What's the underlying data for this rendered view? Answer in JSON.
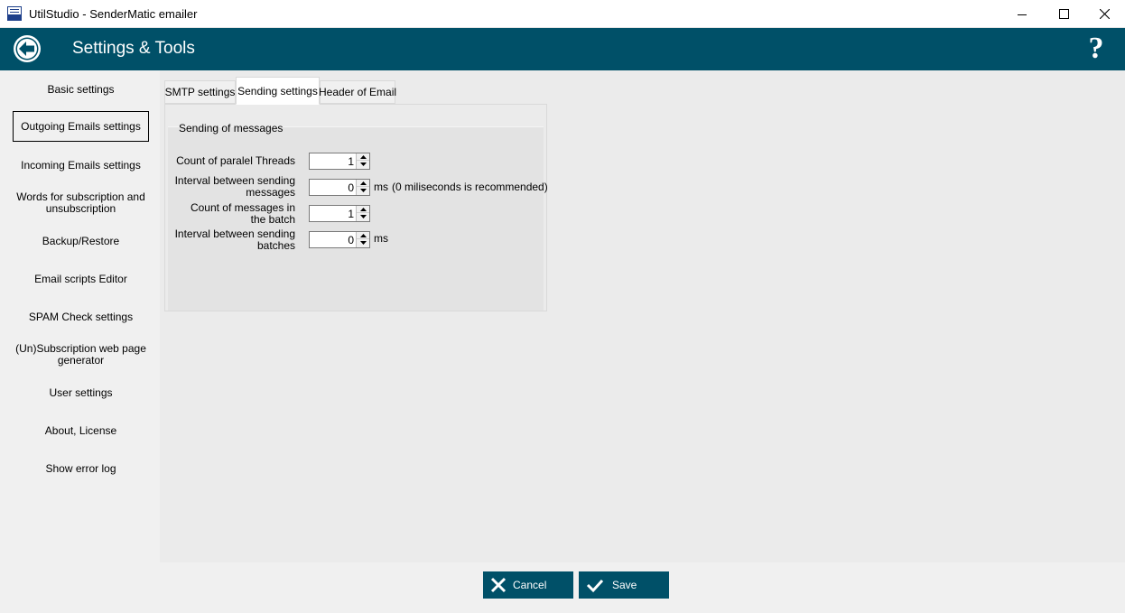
{
  "window": {
    "title": "UtilStudio - SenderMatic emailer"
  },
  "header": {
    "title": "Settings & Tools",
    "help_label": "?"
  },
  "sidebar": {
    "items": [
      {
        "label": "Basic settings"
      },
      {
        "label": "Outgoing Emails settings",
        "active": true
      },
      {
        "label": "Incoming Emails settings"
      },
      {
        "label": "Words for subscription and unsubscription"
      },
      {
        "label": "Backup/Restore"
      },
      {
        "label": "Email scripts Editor"
      },
      {
        "label": "SPAM Check settings"
      },
      {
        "label": "(Un)Subscription web page generator"
      },
      {
        "label": "User settings"
      },
      {
        "label": "About, License"
      },
      {
        "label": "Show error log"
      }
    ]
  },
  "tabs": [
    {
      "label": "SMTP settings"
    },
    {
      "label": "Sending settings",
      "active": true
    },
    {
      "label": "Header of Email"
    }
  ],
  "sending": {
    "group_title": "Sending of messages",
    "fields": [
      {
        "label": "Count of paralel Threads",
        "value": "1",
        "unit": ""
      },
      {
        "label": "Interval between sending messages",
        "value": "0",
        "unit": "ms",
        "hint": "(0 miliseconds is recommended)"
      },
      {
        "label": "Count of messages in the batch",
        "value": "1",
        "unit": ""
      },
      {
        "label": "Interval between sending batches",
        "value": "0",
        "unit": "ms"
      }
    ]
  },
  "footer": {
    "cancel_label": "Cancel",
    "save_label": "Save"
  },
  "colors": {
    "accent": "#005068",
    "background": "#f0f0f0"
  }
}
